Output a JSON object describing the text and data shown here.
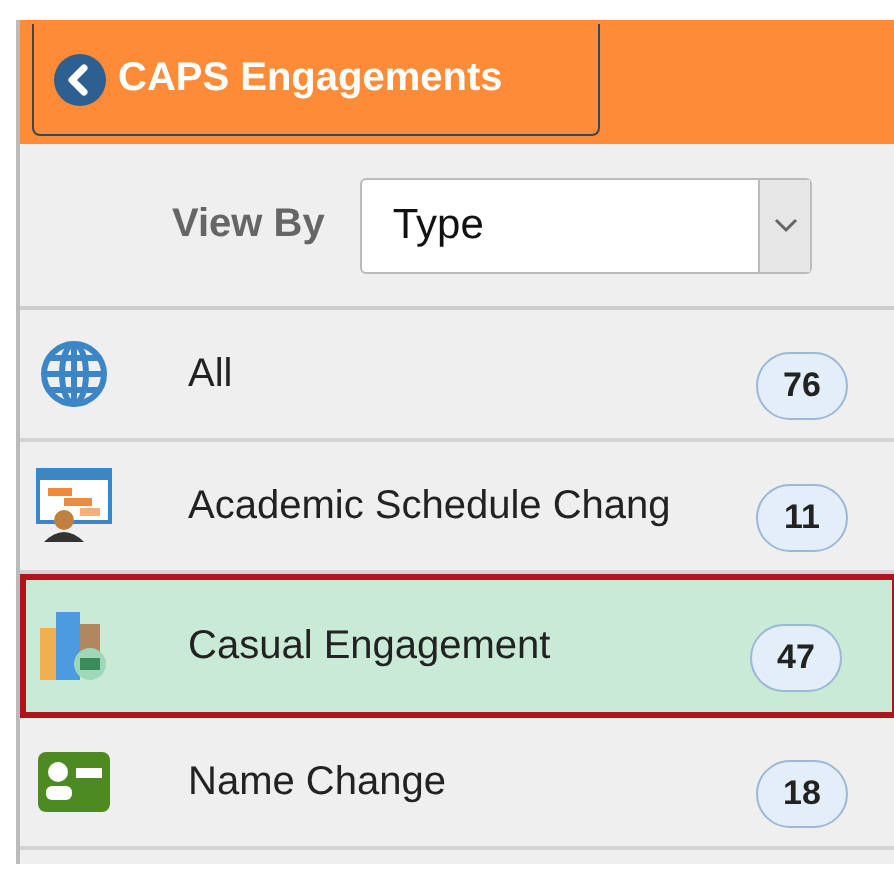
{
  "header": {
    "back_button": "CAPS Engagements"
  },
  "filter": {
    "label": "View By",
    "value": "Type"
  },
  "items": [
    {
      "kind": "globe",
      "label": "All",
      "count": "76",
      "selected": false
    },
    {
      "kind": "schedule",
      "label": "Academic Schedule Chang",
      "count": "11",
      "selected": false
    },
    {
      "kind": "buildings",
      "label": "Casual Engagement",
      "count": "47",
      "selected": true
    },
    {
      "kind": "card",
      "label": "Name Change",
      "count": "18",
      "selected": false
    }
  ]
}
